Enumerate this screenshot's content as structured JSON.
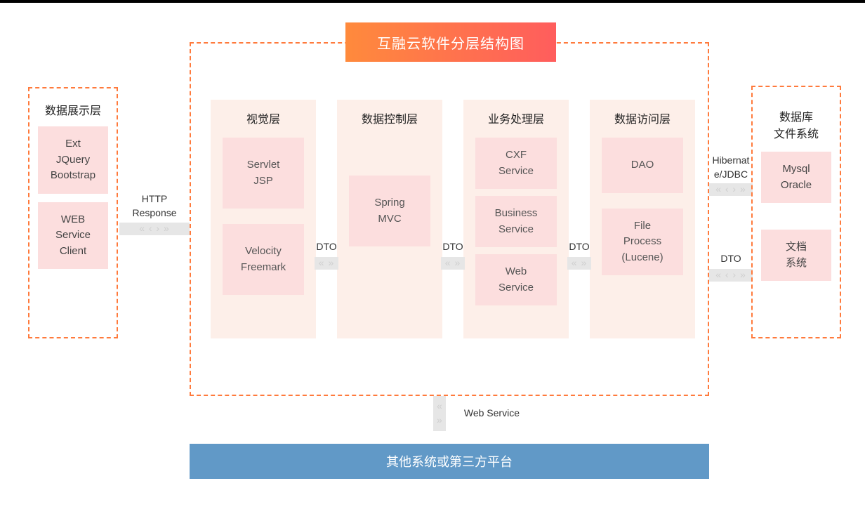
{
  "title": "互融云软件分层结构图",
  "left": {
    "title": "数据展示层",
    "items": [
      "Ext\nJQuery\nBootstrap",
      "WEB\nService\nClient"
    ]
  },
  "right": {
    "title": "数据库\n文件系统",
    "items": [
      "Mysql\nOracle",
      "文档\n系统"
    ]
  },
  "columns": [
    {
      "title": "视觉层",
      "items": [
        "Servlet\nJSP",
        "Velocity\nFreemark"
      ]
    },
    {
      "title": "数据控制层",
      "items": [
        "Spring\nMVC"
      ]
    },
    {
      "title": "业务处理层",
      "items": [
        "CXF\nService",
        "Business\nService",
        "Web\nService"
      ]
    },
    {
      "title": "数据访问层",
      "items": [
        "DAO",
        "File\nProcess\n(Lucene)"
      ]
    }
  ],
  "connectors": {
    "http": "HTTP\nResponse",
    "dto12": "DTO",
    "dto23": "DTO",
    "dto34": "DTO",
    "hib": "Hibernat\ne/JDBC",
    "dtoR": "DTO",
    "ws": "Web Service"
  },
  "bottom": "其他系统或第三方平台"
}
